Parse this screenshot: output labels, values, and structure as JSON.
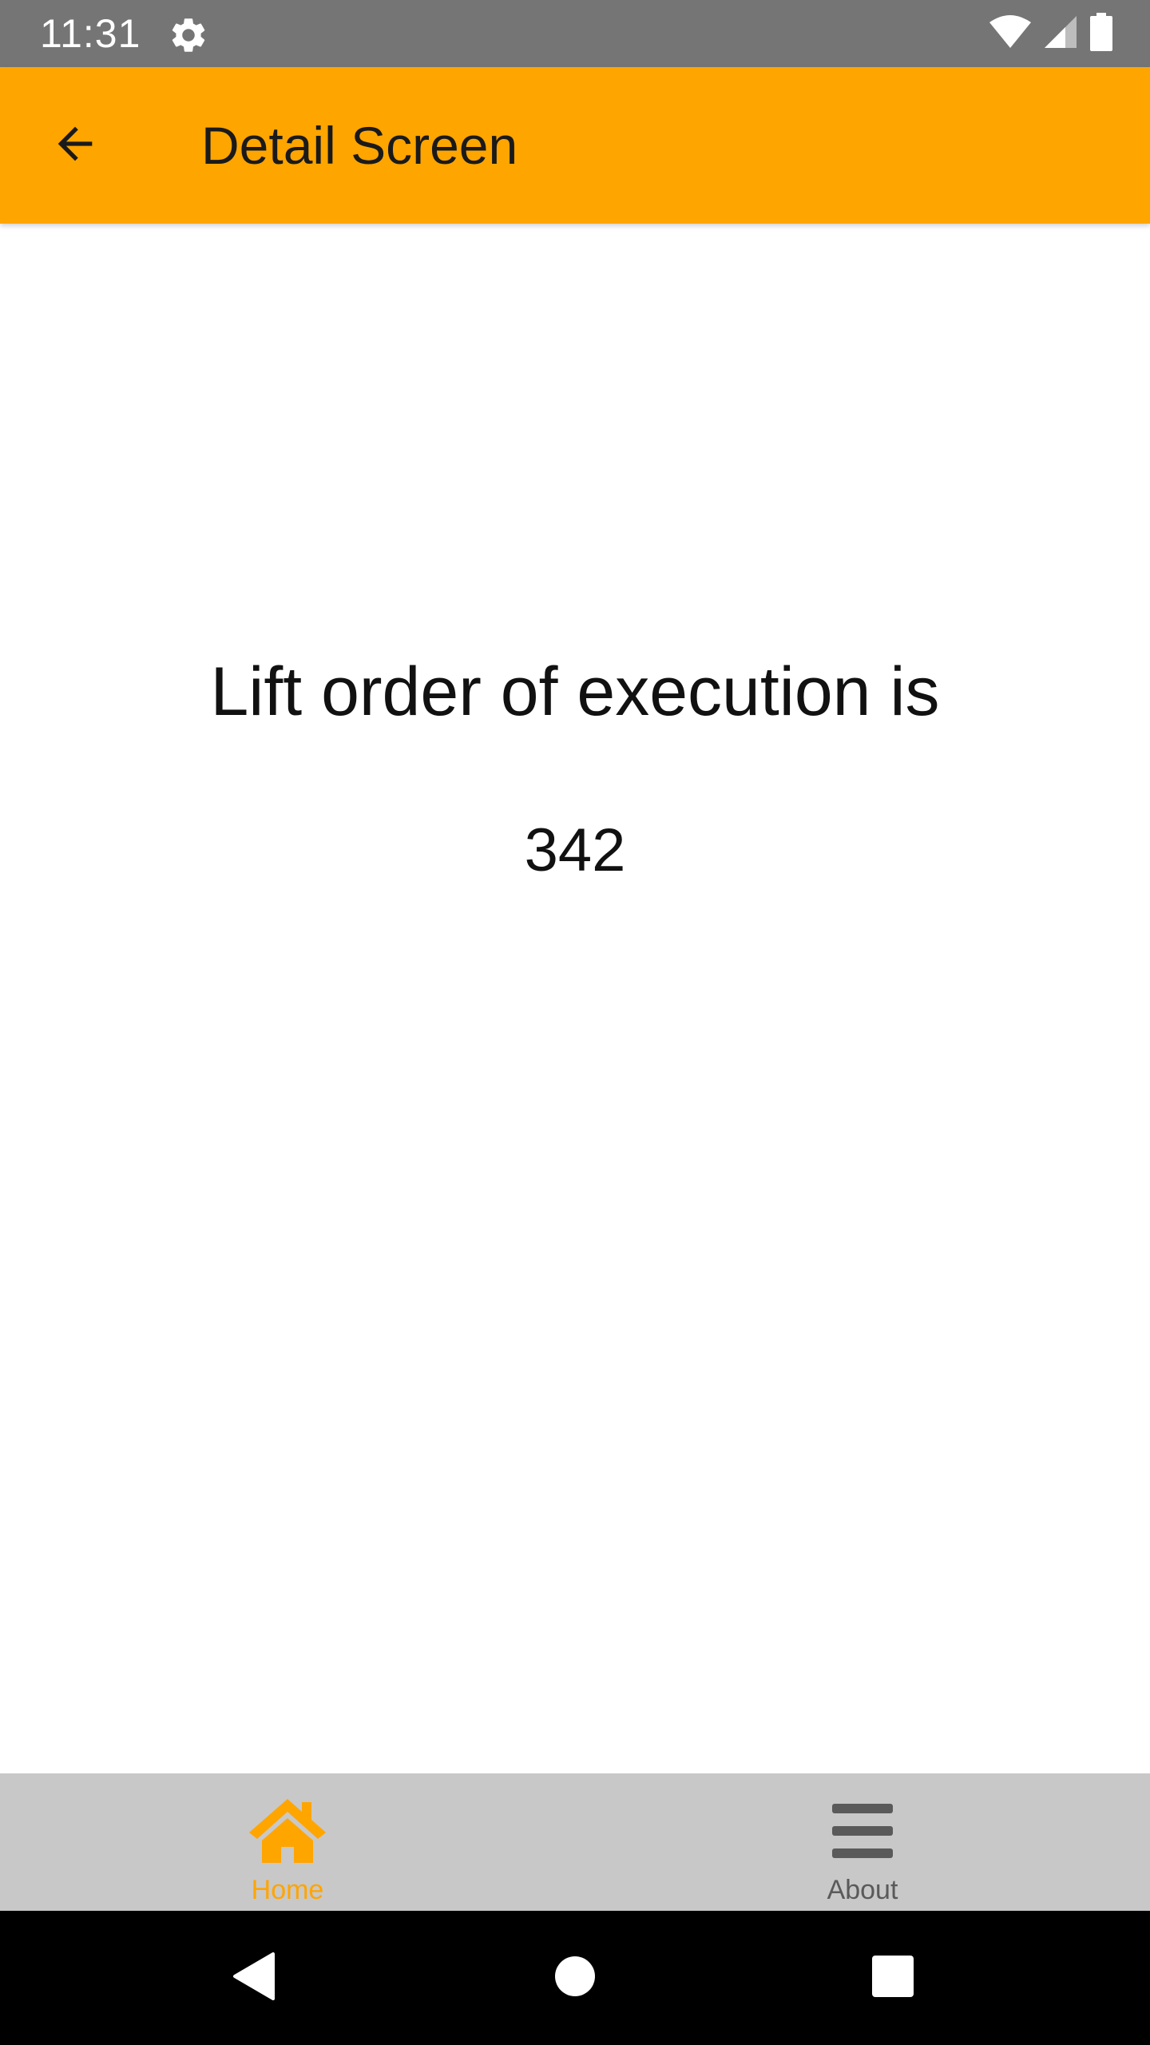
{
  "status_bar": {
    "time": "11:31",
    "icons": [
      "gear-icon",
      "wifi-icon",
      "signal-icon",
      "battery-icon"
    ]
  },
  "app_bar": {
    "title": "Detail Screen",
    "back_icon": "arrow-left-icon",
    "color": "#FFA500"
  },
  "content": {
    "message": "Lift order of execution is",
    "value": "342"
  },
  "tabs": [
    {
      "label": "Home",
      "icon": "home-icon",
      "active": true
    },
    {
      "label": "About",
      "icon": "menu-icon",
      "active": false
    }
  ],
  "colors": {
    "accent": "#FFA500",
    "status_bar": "#757575",
    "tab_bar": "#C8C8C8",
    "inactive_tab": "#5a5a5a"
  },
  "nav_bar": {
    "buttons": [
      "back-triangle-icon",
      "home-circle-icon",
      "recents-square-icon"
    ]
  }
}
